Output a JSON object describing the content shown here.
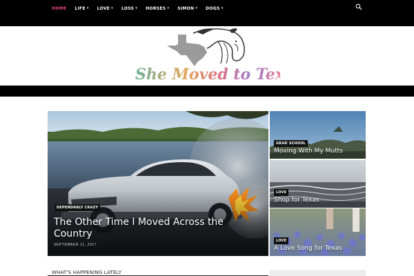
{
  "nav": {
    "items": [
      {
        "label": "HOME",
        "dropdown": false,
        "active": true
      },
      {
        "label": "LIFE",
        "dropdown": true,
        "active": false
      },
      {
        "label": "LOVE",
        "dropdown": true,
        "active": false
      },
      {
        "label": "LOSS",
        "dropdown": true,
        "active": false
      },
      {
        "label": "HORSES",
        "dropdown": true,
        "active": false
      },
      {
        "label": "SIMON",
        "dropdown": true,
        "active": false
      },
      {
        "label": "DOGS",
        "dropdown": true,
        "active": false
      }
    ],
    "chevron": "▾",
    "search_icon": "search-icon",
    "active_color": "#e8497c"
  },
  "logo": {
    "text": "She Moved to Texas"
  },
  "featured": {
    "main": {
      "category": "DEPENDABLY CRAZY",
      "title": "The Other Time I Moved Across the Country",
      "date": "SEPTEMBER 11, 2017"
    },
    "tiles": [
      {
        "category": "GRAD SCHOOL",
        "title": "Moving With My Mutts"
      },
      {
        "category": "LOVE",
        "title": "Shop for Texas"
      },
      {
        "category": "LOVE",
        "title": "A Love Song for Texas"
      }
    ]
  },
  "sections": {
    "happening": "WHAT'S HAPPENING LATELY"
  }
}
